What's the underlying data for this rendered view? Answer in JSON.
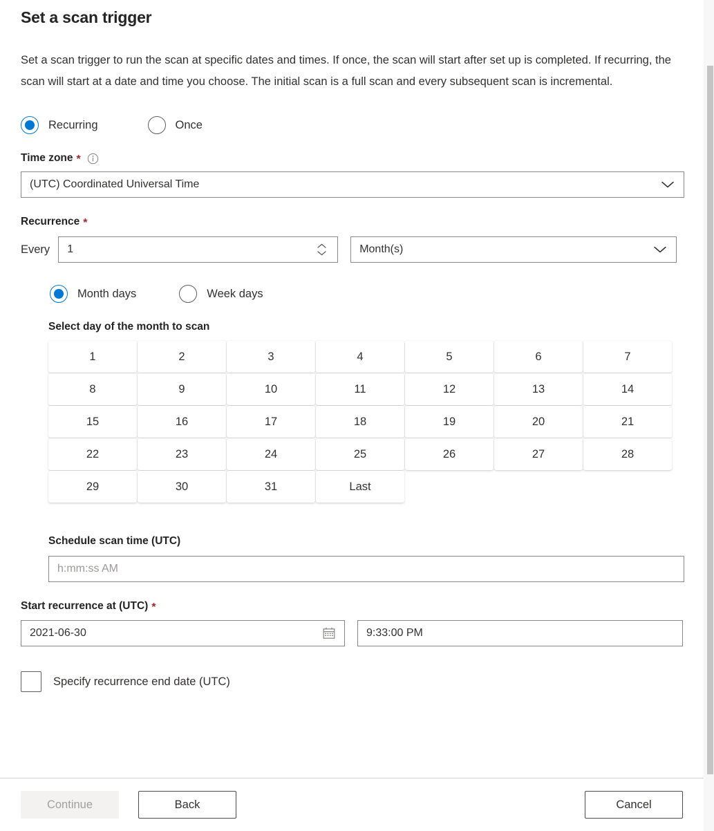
{
  "header": {
    "title": "Set a scan trigger",
    "description": "Set a scan trigger to run the scan at specific dates and times. If once, the scan will start after set up is completed. If recurring, the scan will start at a date and time you choose. The initial scan is a full scan and every subsequent scan is incremental."
  },
  "trigger_mode": {
    "options": [
      {
        "label": "Recurring",
        "selected": true
      },
      {
        "label": "Once",
        "selected": false
      }
    ]
  },
  "time_zone": {
    "label": "Time zone",
    "required_marker": "*",
    "info_icon": "info-circle-icon",
    "value": "(UTC) Coordinated Universal Time",
    "chevron_icon": "chevron-down-icon"
  },
  "recurrence": {
    "label": "Recurrence",
    "required_marker": "*",
    "every_label": "Every",
    "interval_value": "1",
    "spinner_up_icon": "chevron-up-icon",
    "spinner_down_icon": "chevron-down-icon",
    "unit_value": "Month(s)",
    "unit_chevron_icon": "chevron-down-icon",
    "day_mode": {
      "options": [
        {
          "label": "Month days",
          "selected": true
        },
        {
          "label": "Week days",
          "selected": false
        }
      ]
    },
    "day_grid": {
      "caption": "Select day of the month to scan",
      "cells": [
        "1",
        "2",
        "3",
        "4",
        "5",
        "6",
        "7",
        "8",
        "9",
        "10",
        "11",
        "12",
        "13",
        "14",
        "15",
        "16",
        "17",
        "18",
        "19",
        "20",
        "21",
        "22",
        "23",
        "24",
        "25",
        "26",
        "27",
        "28",
        "29",
        "30",
        "31",
        "Last"
      ]
    },
    "schedule_time": {
      "label": "Schedule scan time (UTC)",
      "value": "",
      "placeholder": "h:mm:ss AM"
    }
  },
  "start_recurrence": {
    "label": "Start recurrence at (UTC)",
    "required_marker": "*",
    "date_value": "2021-06-30",
    "calendar_icon": "calendar-icon",
    "time_value": "9:33:00 PM"
  },
  "end_date_checkbox": {
    "label": "Specify recurrence end date (UTC)",
    "checked": false
  },
  "footer": {
    "continue_label": "Continue",
    "continue_disabled": true,
    "back_label": "Back",
    "cancel_label": "Cancel"
  },
  "colors": {
    "accent": "#0078d4",
    "required": "#a4262c",
    "border": "#8a8886",
    "text": "#323130",
    "disabled_text": "#a19f9d",
    "disabled_bg": "#f3f2f1"
  }
}
